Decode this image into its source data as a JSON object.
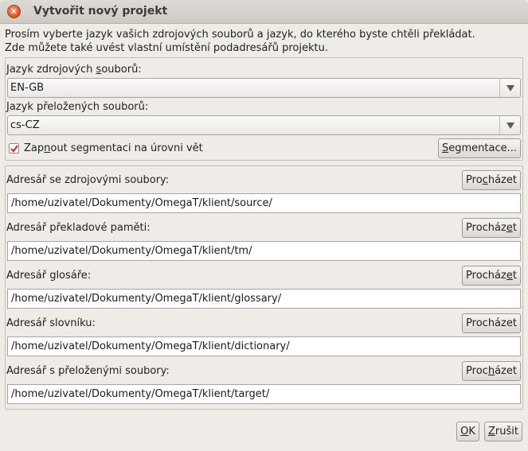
{
  "window": {
    "title": "Vytvořit nový projekt",
    "close_glyph": "✕"
  },
  "description": {
    "line1": "Prosím vyberte jazyk vašich zdrojových souborů a jazyk, do kterého byste chtěli překládat.",
    "line2": "Zde můžete také uvést vlastní umístění podadresářů projektu."
  },
  "languages": {
    "source_label_pre": "Jazyk zdrojových ",
    "source_label_u": "s",
    "source_label_post": "ouborů:",
    "source_value": "EN-GB",
    "target_label_pre": "",
    "target_label_u": "J",
    "target_label_post": "azyk přeložených souborů:",
    "target_value": "cs-CZ",
    "segmentation_check_pre": "Zap",
    "segmentation_check_u": "n",
    "segmentation_check_post": "out segmentaci na úrovni vět",
    "segmentation_checked": true,
    "segmentation_button_u": "S",
    "segmentation_button_post": "egmentace..."
  },
  "directories": [
    {
      "label": "Adresář se zdrojovými soubory:",
      "path": "/home/uzivatel/Dokumenty/OmegaT/klient/source/",
      "btn_pre": "Pro",
      "btn_u": "c",
      "btn_post": "házet"
    },
    {
      "label": "Adresář překladové paměti:",
      "path": "/home/uzivatel/Dokumenty/OmegaT/klient/tm/",
      "btn_pre": "Procház",
      "btn_u": "e",
      "btn_post": "t"
    },
    {
      "label": "Adresář glosáře:",
      "path": "/home/uzivatel/Dokumenty/OmegaT/klient/glossary/",
      "btn_pre": "Procház",
      "btn_u": "e",
      "btn_post": "t"
    },
    {
      "label": "Adresář slovníku:",
      "path": "/home/uzivatel/Dokumenty/OmegaT/klient/dictionary/",
      "btn_pre": "Procházet",
      "btn_u": "",
      "btn_post": ""
    },
    {
      "label": "Adresář s přeloženými soubory:",
      "path": "/home/uzivatel/Dokumenty/OmegaT/klient/target/",
      "btn_pre": "Proc",
      "btn_u": "h",
      "btn_post": "ázet"
    }
  ],
  "footer": {
    "ok_u": "O",
    "ok_post": "K",
    "cancel_u": "Z",
    "cancel_post": "rušit"
  },
  "colors": {
    "close_button": "#d9541c",
    "checkmark": "#c0392b"
  }
}
